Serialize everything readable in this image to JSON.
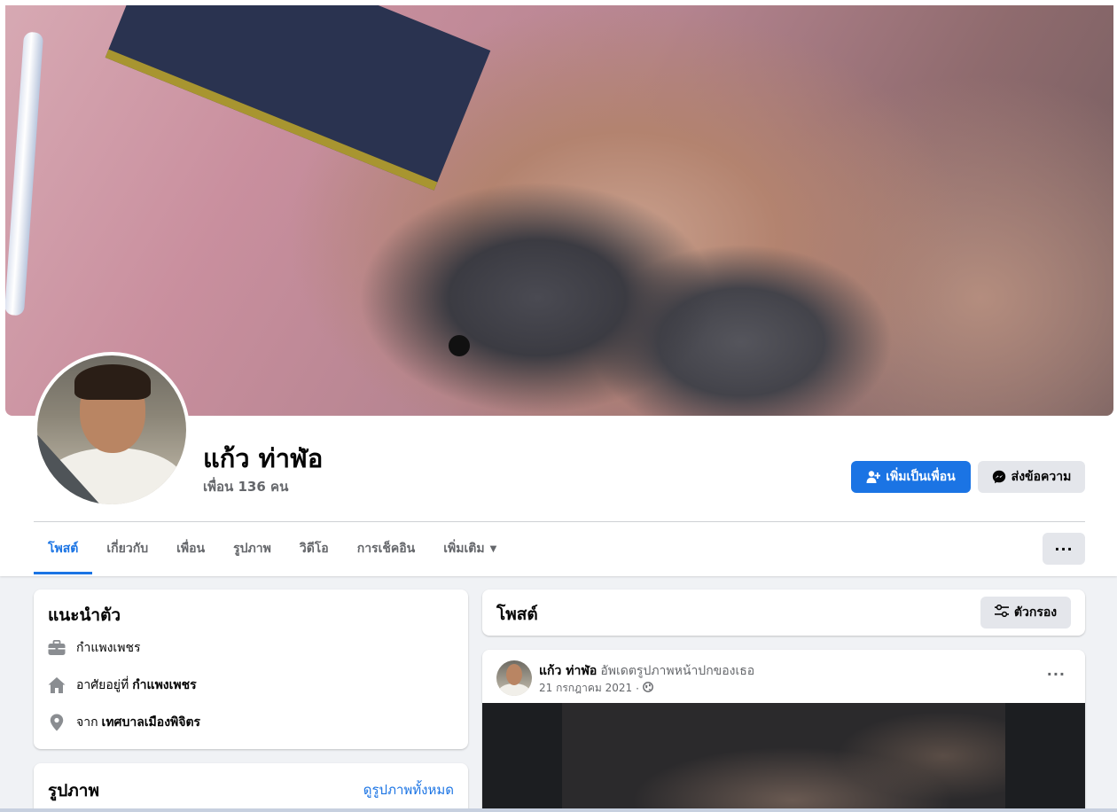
{
  "profile": {
    "name": "แก้ว ท่าฬ่อ",
    "friends": "เพื่อน 136 คน"
  },
  "actions": {
    "add_friend": "เพิ่มเป็นเพื่อน",
    "message": "ส่งข้อความ"
  },
  "tabs": [
    {
      "label": "โพสต์",
      "active": true
    },
    {
      "label": "เกี่ยวกับ",
      "active": false
    },
    {
      "label": "เพื่อน",
      "active": false
    },
    {
      "label": "รูปภาพ",
      "active": false
    },
    {
      "label": "วิดีโอ",
      "active": false
    },
    {
      "label": "การเช็คอิน",
      "active": false
    },
    {
      "label": "เพิ่มเติม",
      "active": false
    }
  ],
  "more_button": "···",
  "intro": {
    "title": "แนะนำตัว",
    "work": "กำแพงเพชร",
    "lives_prefix": "อาศัยอยู่ที่",
    "lives_value": "กำแพงเพชร",
    "from_prefix": "จาก",
    "from_value": "เทศบาลเมืองพิจิตร"
  },
  "photos": {
    "title": "รูปภาพ",
    "see_all": "ดูรูปภาพทั้งหมด"
  },
  "posts": {
    "title": "โพสต์",
    "filter": "ตัวกรอง"
  },
  "post": {
    "author": "แก้ว ท่าฬ่อ",
    "action": "อัพเดตรูปภาพหน้าปกของเธอ",
    "date": "21 กรกฎาคม 2021",
    "separator": "·",
    "more": "···"
  },
  "colors": {
    "accent": "#1b74e4",
    "background": "#f0f2f5",
    "secondary_button": "#e4e6eb"
  },
  "icons": {
    "work": "briefcase-icon",
    "home": "home-icon",
    "location": "location-pin-icon",
    "privacy": "globe-icon",
    "add_friend": "add-person-icon",
    "message": "messenger-icon",
    "filter": "filter-sliders-icon",
    "dropdown": "caret-down-icon"
  }
}
